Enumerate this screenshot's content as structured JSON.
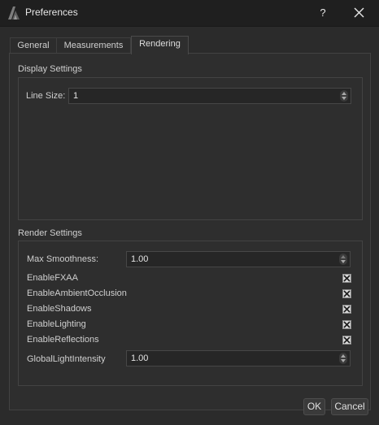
{
  "window": {
    "title": "Preferences",
    "help_label": "?"
  },
  "tabs": [
    {
      "label": "General"
    },
    {
      "label": "Measurements"
    },
    {
      "label": "Rendering"
    }
  ],
  "display": {
    "title": "Display Settings",
    "line_size_label": "Line Size:",
    "line_size_value": "1"
  },
  "render": {
    "title": "Render Settings",
    "max_smoothness_label": "Max Smoothness:",
    "max_smoothness_value": "1.00",
    "options": [
      {
        "label": "EnableFXAA",
        "checked": true
      },
      {
        "label": "EnableAmbientOcclusion",
        "checked": true
      },
      {
        "label": "EnableShadows",
        "checked": true
      },
      {
        "label": "EnableLighting",
        "checked": true
      },
      {
        "label": "EnableReflections",
        "checked": true
      }
    ],
    "global_light_label": "GlobalLightIntensity",
    "global_light_value": "1.00"
  },
  "buttons": {
    "ok": "OK",
    "cancel": "Cancel"
  }
}
